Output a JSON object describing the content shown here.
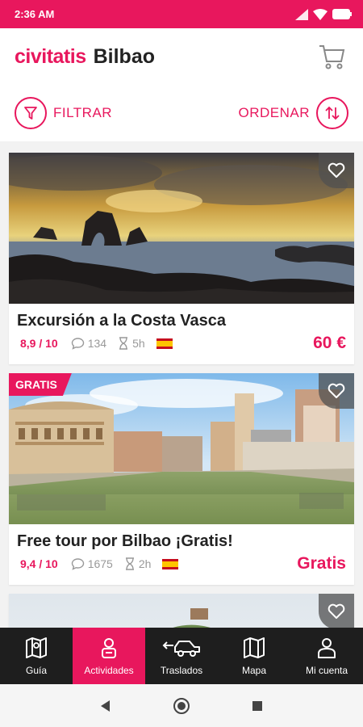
{
  "status": {
    "time": "2:36 AM"
  },
  "header": {
    "brand": "civitatis",
    "city": "Bilbao",
    "cart_icon": "cart-icon"
  },
  "toolbar": {
    "filter_label": "FILTRAR",
    "sort_label": "ORDENAR"
  },
  "colors": {
    "accent": "#e8175d",
    "tabbar": "#1e1e1e"
  },
  "activities": [
    {
      "title": "Excursión a la Costa Vasca",
      "rating": "8,9 / 10",
      "reviews": "134",
      "duration": "5h",
      "language": "es",
      "price": "60 €",
      "badge": ""
    },
    {
      "title": "Free tour por Bilbao ¡Gratis!",
      "rating": "9,4 / 10",
      "reviews": "1675",
      "duration": "2h",
      "language": "es",
      "price": "Gratis",
      "badge": "GRATIS"
    }
  ],
  "tabs": [
    {
      "label": "Guía",
      "icon": "map-book-icon",
      "active": false
    },
    {
      "label": "Actividades",
      "icon": "person-icon",
      "active": true
    },
    {
      "label": "Traslados",
      "icon": "car-icon",
      "active": false
    },
    {
      "label": "Mapa",
      "icon": "map-icon",
      "active": false
    },
    {
      "label": "Mi cuenta",
      "icon": "account-icon",
      "active": false
    }
  ]
}
